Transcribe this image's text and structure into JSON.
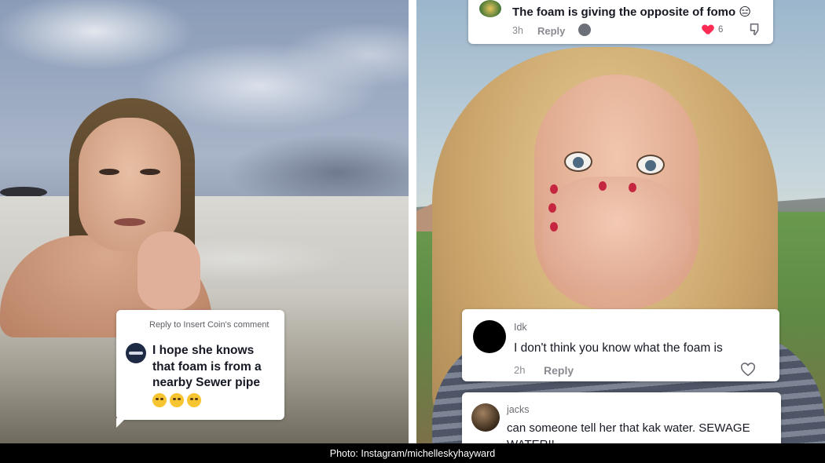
{
  "left_panel": {
    "reply_card": {
      "reply_to": "Reply to Insert Coin's comment",
      "text": "I hope she knows that foam is from a nearby Sewer pipe",
      "emojis": [
        "grinning-face-with-sweat",
        "grinning-face-with-sweat",
        "grinning-face-with-sweat"
      ]
    }
  },
  "right_panel": {
    "comments": [
      {
        "username": "",
        "text": "The foam is giving the opposite of fomo 😑",
        "time": "3h",
        "reply_label": "Reply",
        "likes": "6"
      },
      {
        "username": "Idk",
        "text": "I don't think you know what the foam is",
        "time": "2h",
        "reply_label": "Reply"
      },
      {
        "username": "jacks",
        "text": "can someone tell her that kak water. SEWAGE",
        "text_cut": "WATER!!"
      }
    ]
  },
  "caption": "Photo: Instagram/michelleskyhayward",
  "colors": {
    "like_red": "#fe2c55",
    "caption_bg": "#000000"
  }
}
